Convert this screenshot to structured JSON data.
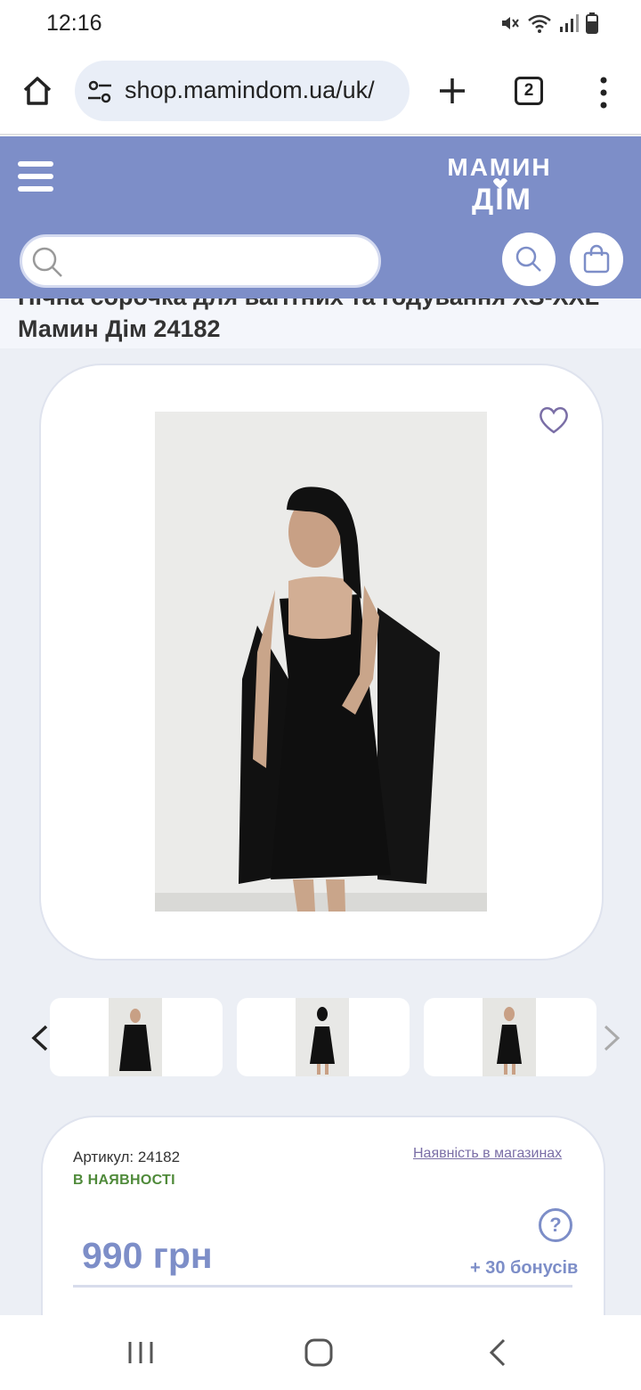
{
  "status_bar": {
    "time": "12:16"
  },
  "browser": {
    "url": "shop.mamindom.ua/uk/",
    "tab_count": "2"
  },
  "header": {
    "logo_line1": "МАМИН",
    "logo_line2": "ДІМ",
    "search_placeholder": "",
    "brand_color": "#7d8ec8"
  },
  "product": {
    "title": "Нічна сорочка для вагітних та годування XS-XXL Мамин Дім 24182",
    "article_label": "Артикул: 24182",
    "stock_link": "Наявність в магазинах",
    "availability": "В НАЯВНОСТІ",
    "price": "990 грн",
    "bonus": "+ 30 бонусів",
    "help_symbol": "?"
  },
  "colors": {
    "accent": "#7d8ec8",
    "in_stock": "#4f8a3a",
    "link": "#7a6ea6"
  }
}
